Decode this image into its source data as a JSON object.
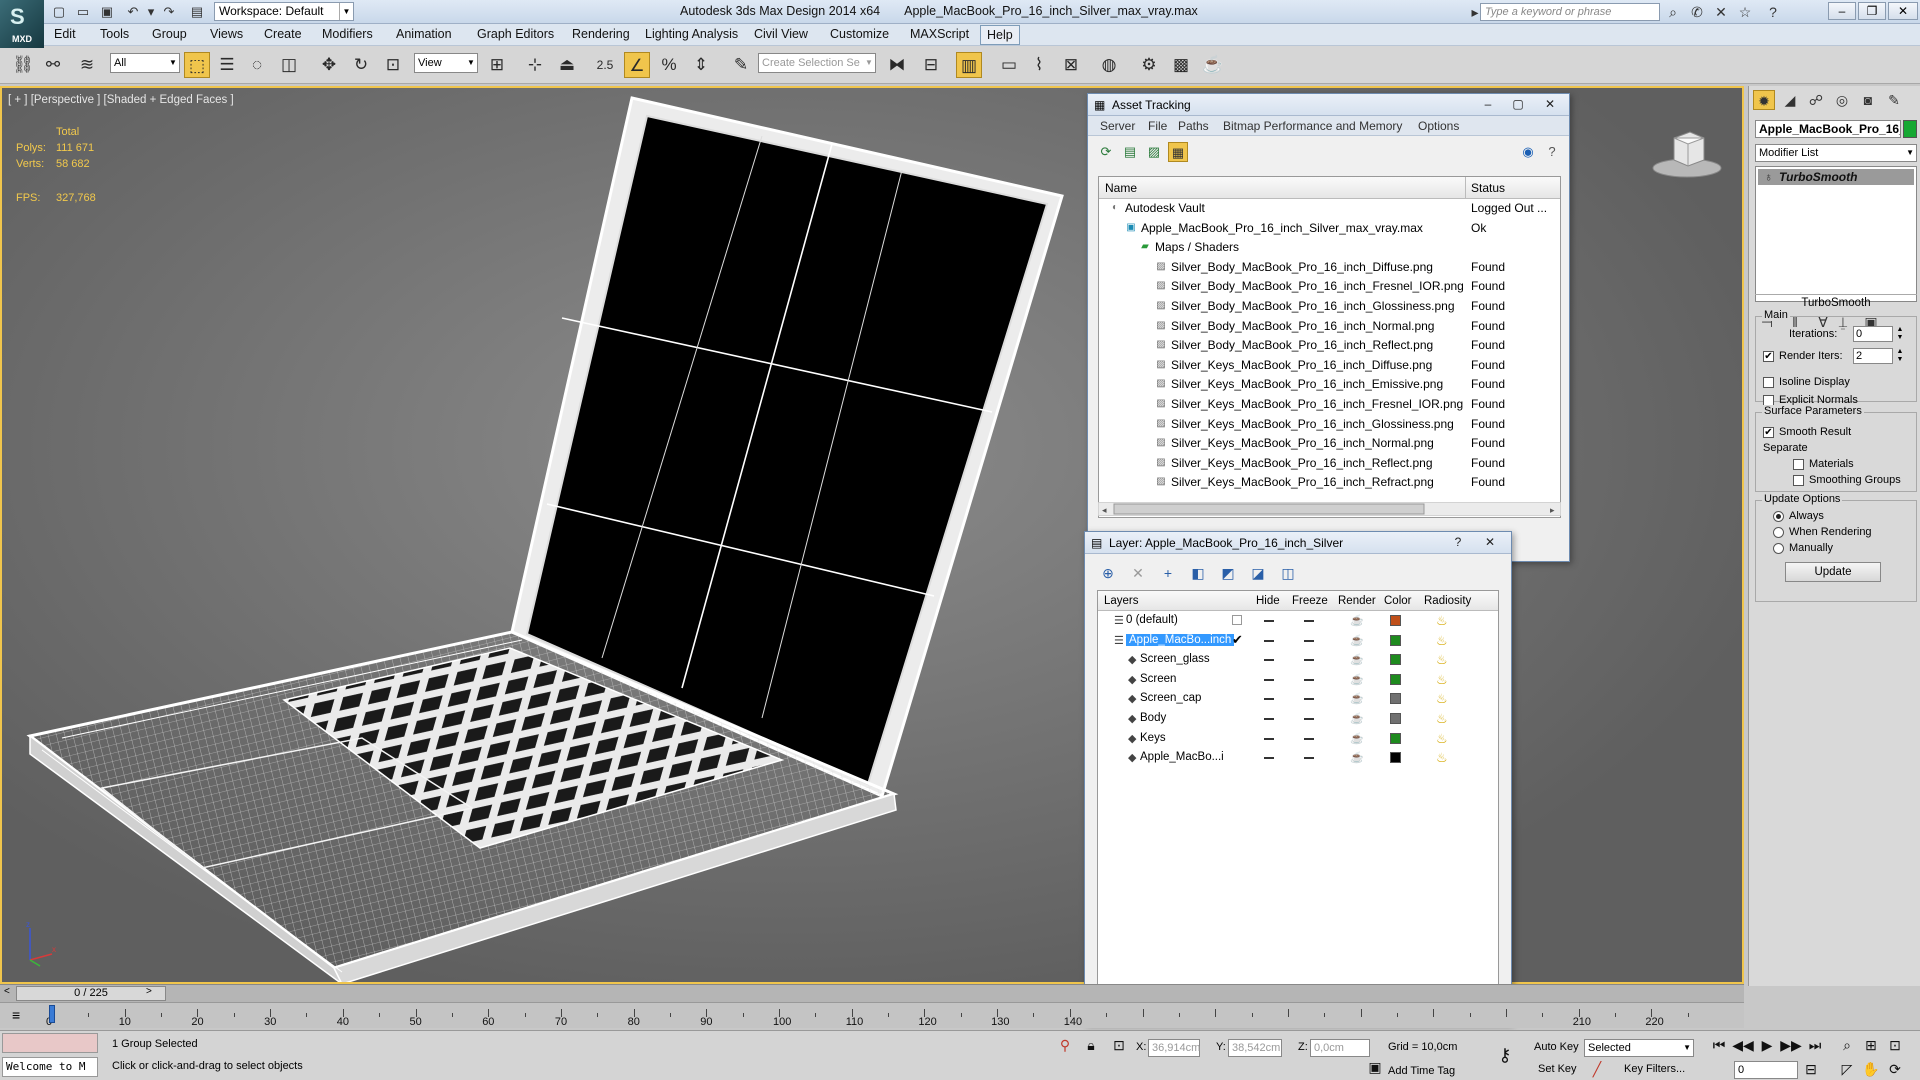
{
  "titlebar": {
    "logo": "MXD",
    "workspace": "Workspace: Default",
    "app_title": "Autodesk 3ds Max Design 2014 x64",
    "file_title": "Apple_MacBook_Pro_16_inch_Silver_max_vray.max",
    "search_placeholder": "Type a keyword or phrase"
  },
  "menu": [
    "Edit",
    "Tools",
    "Group",
    "Views",
    "Create",
    "Modifiers",
    "Animation",
    "Graph Editors",
    "Rendering",
    "Lighting Analysis",
    "Civil View",
    "Customize",
    "MAXScript",
    "Help"
  ],
  "toolbar": {
    "filter": "All",
    "refcoord": "View",
    "snap_value": "2.5",
    "selection_set_placeholder": "Create Selection Se"
  },
  "viewport": {
    "label": "[ + ] [Perspective ] [Shaded + Edged Faces ]",
    "total_label": "Total",
    "polys_label": "Polys:",
    "polys_value": "111 671",
    "verts_label": "Verts:",
    "verts_value": "58 682",
    "fps_label": "FPS:",
    "fps_value": "327,768"
  },
  "command_panel": {
    "object_name": "Apple_MacBook_Pro_16_",
    "object_color": "#16a833",
    "modifier_list": "Modifier List",
    "stack_item": "TurboSmooth",
    "rollout_title": "TurboSmooth",
    "main_group": "Main",
    "iterations_label": "Iterations:",
    "iterations_value": "0",
    "render_iters_label": "Render Iters:",
    "render_iters_value": "2",
    "isoline_label": "Isoline Display",
    "explicit_label": "Explicit Normals",
    "surface_group": "Surface Parameters",
    "smooth_result_label": "Smooth Result",
    "separate_label": "Separate",
    "materials_label": "Materials",
    "smoothing_groups_label": "Smoothing Groups",
    "update_group": "Update Options",
    "always_label": "Always",
    "when_rendering_label": "When Rendering",
    "manually_label": "Manually",
    "update_button": "Update"
  },
  "asset_tracking": {
    "title": "Asset Tracking",
    "menu": [
      "Server",
      "File",
      "Paths",
      "Bitmap Performance and Memory",
      "Options"
    ],
    "col_name": "Name",
    "col_status": "Status",
    "rows": [
      {
        "name": "Autodesk Vault",
        "status": "Logged Out ...",
        "indent": 0
      },
      {
        "name": "Apple_MacBook_Pro_16_inch_Silver_max_vray.max",
        "status": "Ok",
        "indent": 1
      },
      {
        "name": "Maps / Shaders",
        "status": "",
        "indent": 2
      },
      {
        "name": "Silver_Body_MacBook_Pro_16_inch_Diffuse.png",
        "status": "Found",
        "indent": 3
      },
      {
        "name": "Silver_Body_MacBook_Pro_16_inch_Fresnel_IOR.png",
        "status": "Found",
        "indent": 3
      },
      {
        "name": "Silver_Body_MacBook_Pro_16_inch_Glossiness.png",
        "status": "Found",
        "indent": 3
      },
      {
        "name": "Silver_Body_MacBook_Pro_16_inch_Normal.png",
        "status": "Found",
        "indent": 3
      },
      {
        "name": "Silver_Body_MacBook_Pro_16_inch_Reflect.png",
        "status": "Found",
        "indent": 3
      },
      {
        "name": "Silver_Keys_MacBook_Pro_16_inch_Diffuse.png",
        "status": "Found",
        "indent": 3
      },
      {
        "name": "Silver_Keys_MacBook_Pro_16_inch_Emissive.png",
        "status": "Found",
        "indent": 3
      },
      {
        "name": "Silver_Keys_MacBook_Pro_16_inch_Fresnel_IOR.png",
        "status": "Found",
        "indent": 3
      },
      {
        "name": "Silver_Keys_MacBook_Pro_16_inch_Glossiness.png",
        "status": "Found",
        "indent": 3
      },
      {
        "name": "Silver_Keys_MacBook_Pro_16_inch_Normal.png",
        "status": "Found",
        "indent": 3
      },
      {
        "name": "Silver_Keys_MacBook_Pro_16_inch_Reflect.png",
        "status": "Found",
        "indent": 3
      },
      {
        "name": "Silver_Keys_MacBook_Pro_16_inch_Refract.png",
        "status": "Found",
        "indent": 3
      }
    ]
  },
  "layer_window": {
    "title": "Layer: Apple_MacBook_Pro_16_inch_Silver",
    "headers": {
      "layers": "Layers",
      "hide": "Hide",
      "freeze": "Freeze",
      "render": "Render",
      "color": "Color",
      "radiosity": "Radiosity"
    },
    "rows": [
      {
        "name": "0 (default)",
        "color": "#c0501a",
        "indent": 0
      },
      {
        "name": "Apple_MacBo...inch",
        "color": "#1e8a1e",
        "indent": 0
      },
      {
        "name": "Screen_glass",
        "color": "#1e8a1e",
        "indent": 1
      },
      {
        "name": "Screen",
        "color": "#1e8a1e",
        "indent": 1
      },
      {
        "name": "Screen_cap",
        "color": "#707070",
        "indent": 1
      },
      {
        "name": "Body",
        "color": "#707070",
        "indent": 1
      },
      {
        "name": "Keys",
        "color": "#1e8a1e",
        "indent": 1
      },
      {
        "name": "Apple_MacBo...i",
        "color": "#000000",
        "indent": 1
      }
    ]
  },
  "timeline": {
    "frame": "0 / 225",
    "ticks": [
      "0",
      "10",
      "20",
      "30",
      "40",
      "50",
      "60",
      "70",
      "80",
      "90",
      "100",
      "110",
      "120",
      "130",
      "140",
      "210",
      "220"
    ]
  },
  "status": {
    "selection": "1 Group Selected",
    "prompt": "Click or click-and-drag to select objects",
    "welcome": "Welcome to M",
    "x_label": "X:",
    "x_value": "36,914cm",
    "y_label": "Y:",
    "y_value": "38,542cm",
    "z_label": "Z:",
    "z_value": "0,0cm",
    "grid": "Grid = 10,0cm",
    "add_time_tag": "Add Time Tag",
    "auto_key": "Auto Key",
    "set_key": "Set Key",
    "selected_combo": "Selected",
    "key_filters": "Key Filters...",
    "current_frame": "0"
  }
}
